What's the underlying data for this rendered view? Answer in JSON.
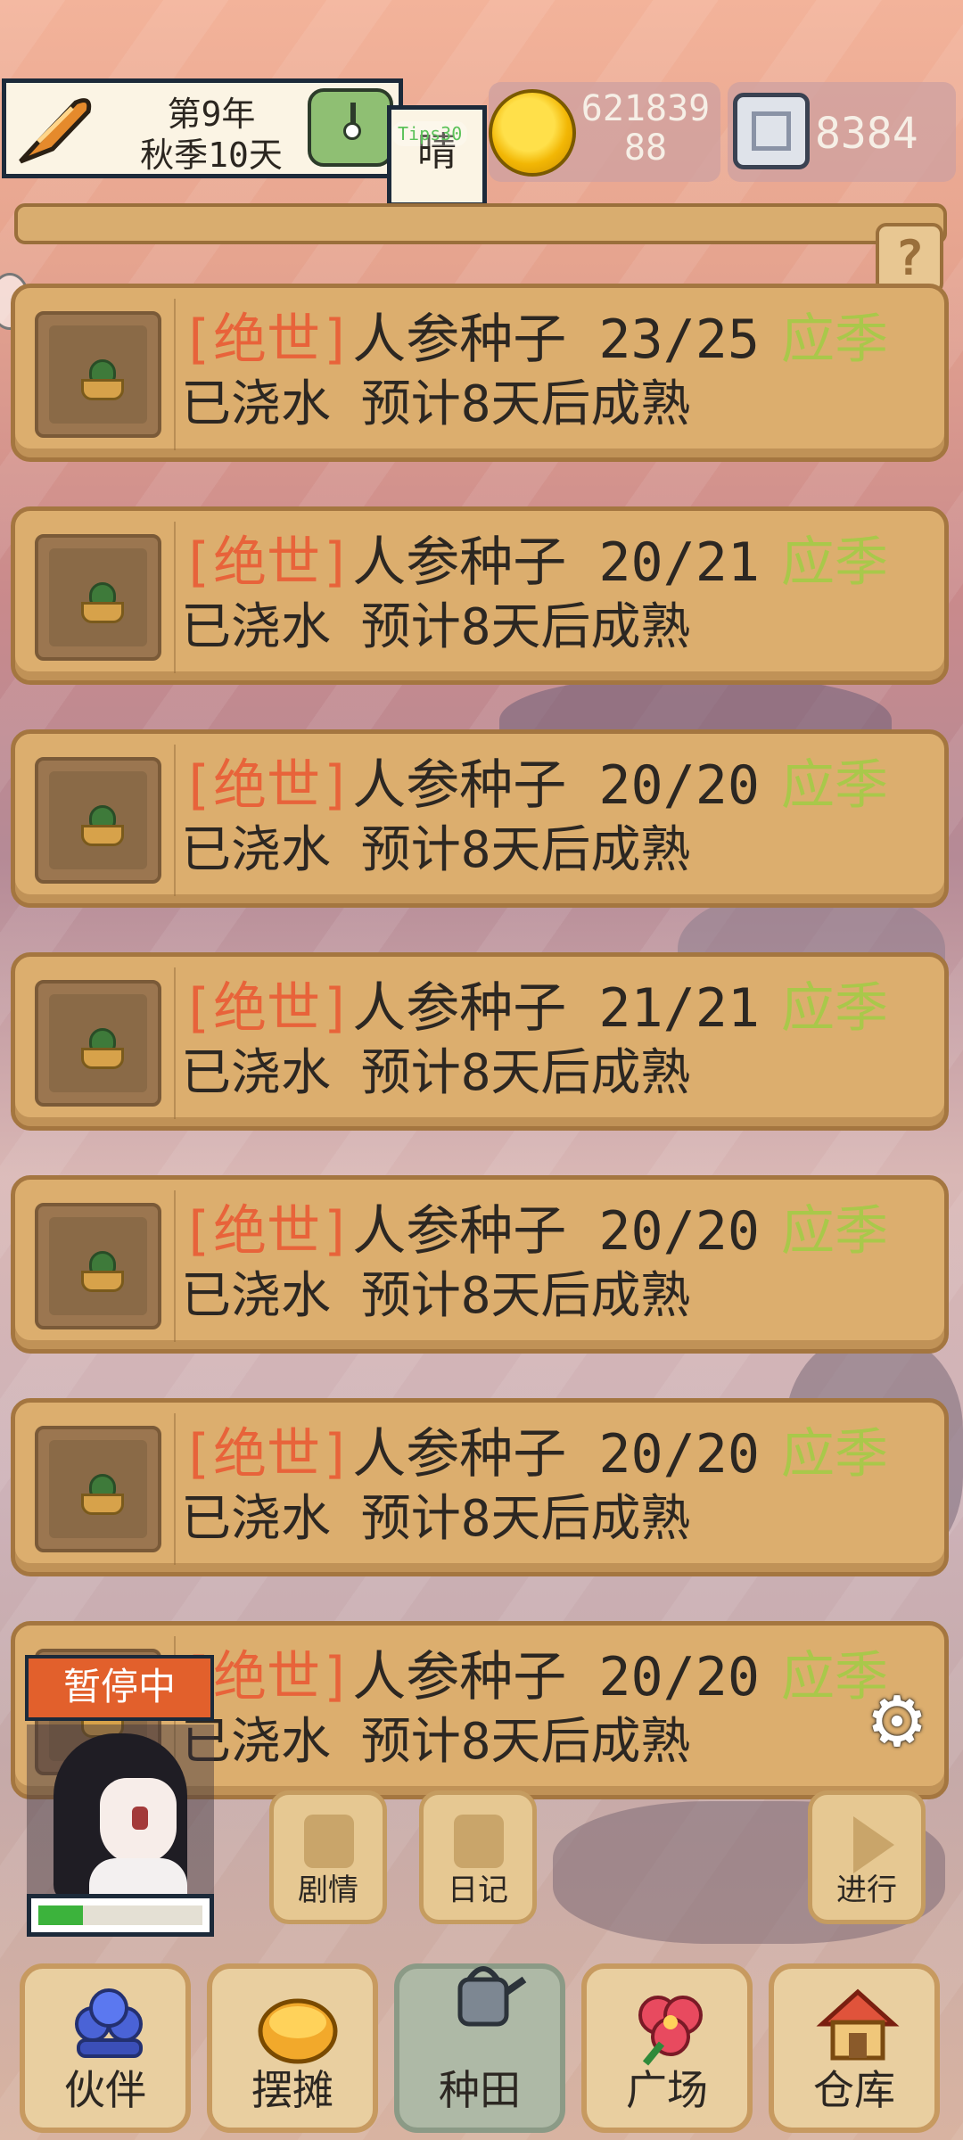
{
  "top_bar": {
    "date_line1": "第9年",
    "date_line2": "秋季10天",
    "weather": "晴",
    "badge_text": "Tips30",
    "gold_line1": "621839",
    "gold_line2": "88",
    "gems": "8384",
    "help_label": "?"
  },
  "plots": [
    {
      "grade": "[绝世]",
      "name": "人参种子",
      "progress": "23/25",
      "season": "应季",
      "status": "已浇水 预计8天后成熟"
    },
    {
      "grade": "[绝世]",
      "name": "人参种子",
      "progress": "20/21",
      "season": "应季",
      "status": "已浇水 预计8天后成熟"
    },
    {
      "grade": "[绝世]",
      "name": "人参种子",
      "progress": "20/20",
      "season": "应季",
      "status": "已浇水 预计8天后成熟"
    },
    {
      "grade": "[绝世]",
      "name": "人参种子",
      "progress": "21/21",
      "season": "应季",
      "status": "已浇水 预计8天后成熟"
    },
    {
      "grade": "[绝世]",
      "name": "人参种子",
      "progress": "20/20",
      "season": "应季",
      "status": "已浇水 预计8天后成熟"
    },
    {
      "grade": "[绝世]",
      "name": "人参种子",
      "progress": "20/20",
      "season": "应季",
      "status": "已浇水 预计8天后成熟"
    },
    {
      "grade": "[绝世]",
      "name": "人参种子",
      "progress": "20/20",
      "season": "应季",
      "status": "已浇水 预计8天后成熟"
    }
  ],
  "status": {
    "paused_label": "暂停中",
    "stamina_fraction": 0.27
  },
  "actions": {
    "story_label": "剧情",
    "diary_label": "日记",
    "proceed_label": "进行"
  },
  "bottom_nav": [
    {
      "label": "伙伴",
      "icon": "companion-icon"
    },
    {
      "label": "摆摊",
      "icon": "stall-coins-icon"
    },
    {
      "label": "种田",
      "icon": "watering-can-icon",
      "active": true
    },
    {
      "label": "广场",
      "icon": "flower-icon"
    },
    {
      "label": "仓库",
      "icon": "house-icon"
    }
  ],
  "colors": {
    "grade": "#e8633a",
    "season": "#a9c84a",
    "card": "#dcae6e",
    "paused": "#e2602c"
  }
}
